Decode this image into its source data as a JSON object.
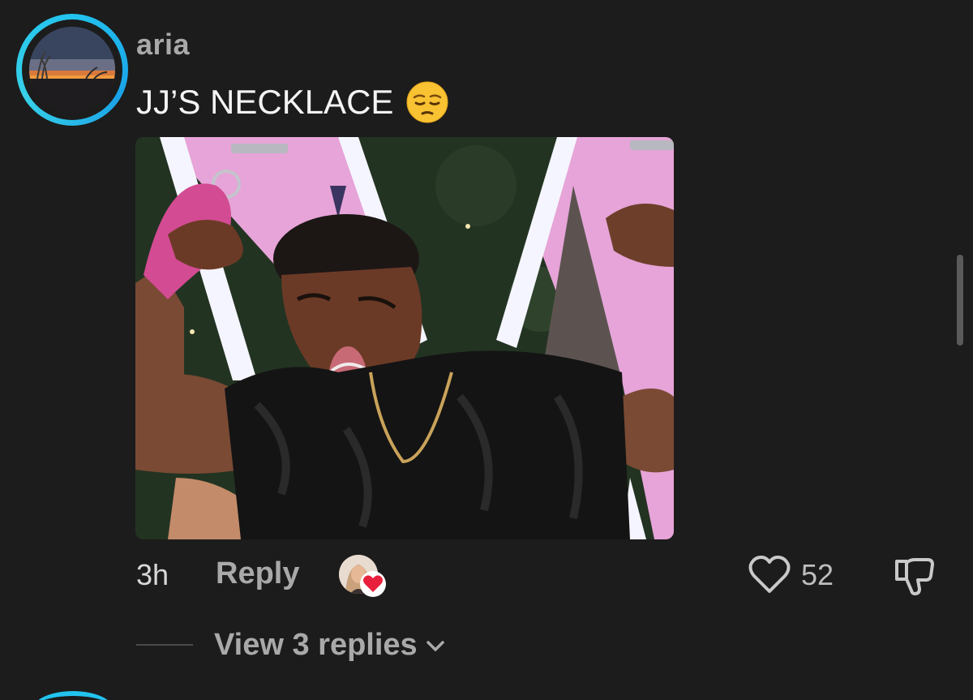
{
  "comment": {
    "username": "aria",
    "text": "JJ’S NECKLACE",
    "emoji": "pensive-face-emoji",
    "timestamp": "3h",
    "reply_label": "Reply",
    "like_count": "52",
    "view_replies_label": "View 3 replies"
  },
  "icons": {
    "like": "heart-outline-icon",
    "dislike": "thumbs-down-icon",
    "chevron": "chevron-down-icon",
    "creator_heart": "red-heart-icon"
  },
  "colors": {
    "background": "#1c1c1c",
    "avatar_ring": "#22c3ee",
    "username": "#a9a9a9",
    "comment_text": "#f4f4f4",
    "heart_red": "#e8203c"
  }
}
